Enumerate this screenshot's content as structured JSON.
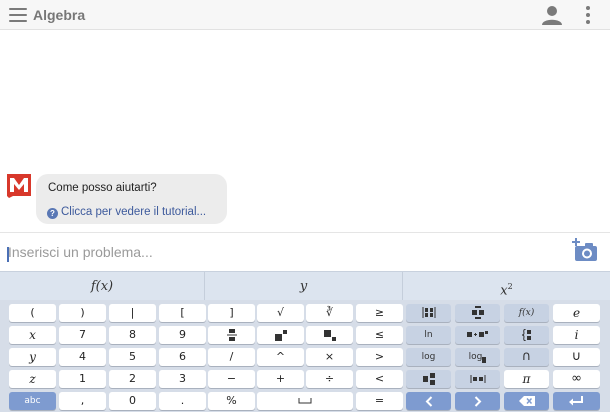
{
  "header": {
    "title": "Algebra",
    "icons": [
      "menu-icon",
      "user-icon",
      "more-icon"
    ]
  },
  "chat": {
    "message": "Come posso aiutarti?",
    "tutorial_link": "Clicca per vedere il tutorial..."
  },
  "input": {
    "placeholder": "Inserisci un problema...",
    "camera_icon": "camera-plus-icon"
  },
  "keyboard": {
    "tabs": [
      {
        "label": "f(x)"
      },
      {
        "label": "y"
      },
      {
        "label": "x",
        "sup": "2"
      }
    ],
    "rows": [
      [
        "(",
        ")",
        "|",
        "[",
        "]",
        "√",
        "∛",
        "≥"
      ],
      [
        "x",
        "7",
        "8",
        "9",
        "",
        "",
        "",
        "≤"
      ],
      [
        "y",
        "4",
        "5",
        "6",
        "/",
        "^",
        "×",
        ">"
      ],
      [
        "z",
        "1",
        "2",
        "3",
        "−",
        "+",
        "÷",
        "<"
      ],
      [
        "abc",
        ",",
        "0",
        ".",
        "%",
        "",
        "="
      ]
    ],
    "fn_keys": {
      "f_of_x": "f(x)",
      "e": "e",
      "ln": "ln",
      "i": "i",
      "log": "log",
      "log_base": "log",
      "cap": "∩",
      "cup": "∪",
      "pi": "π",
      "infinity": "∞"
    },
    "colors": {
      "accent": "#7e9bd0",
      "keyboard_bg": "#d6dde8",
      "link": "#3d5a9c"
    }
  }
}
